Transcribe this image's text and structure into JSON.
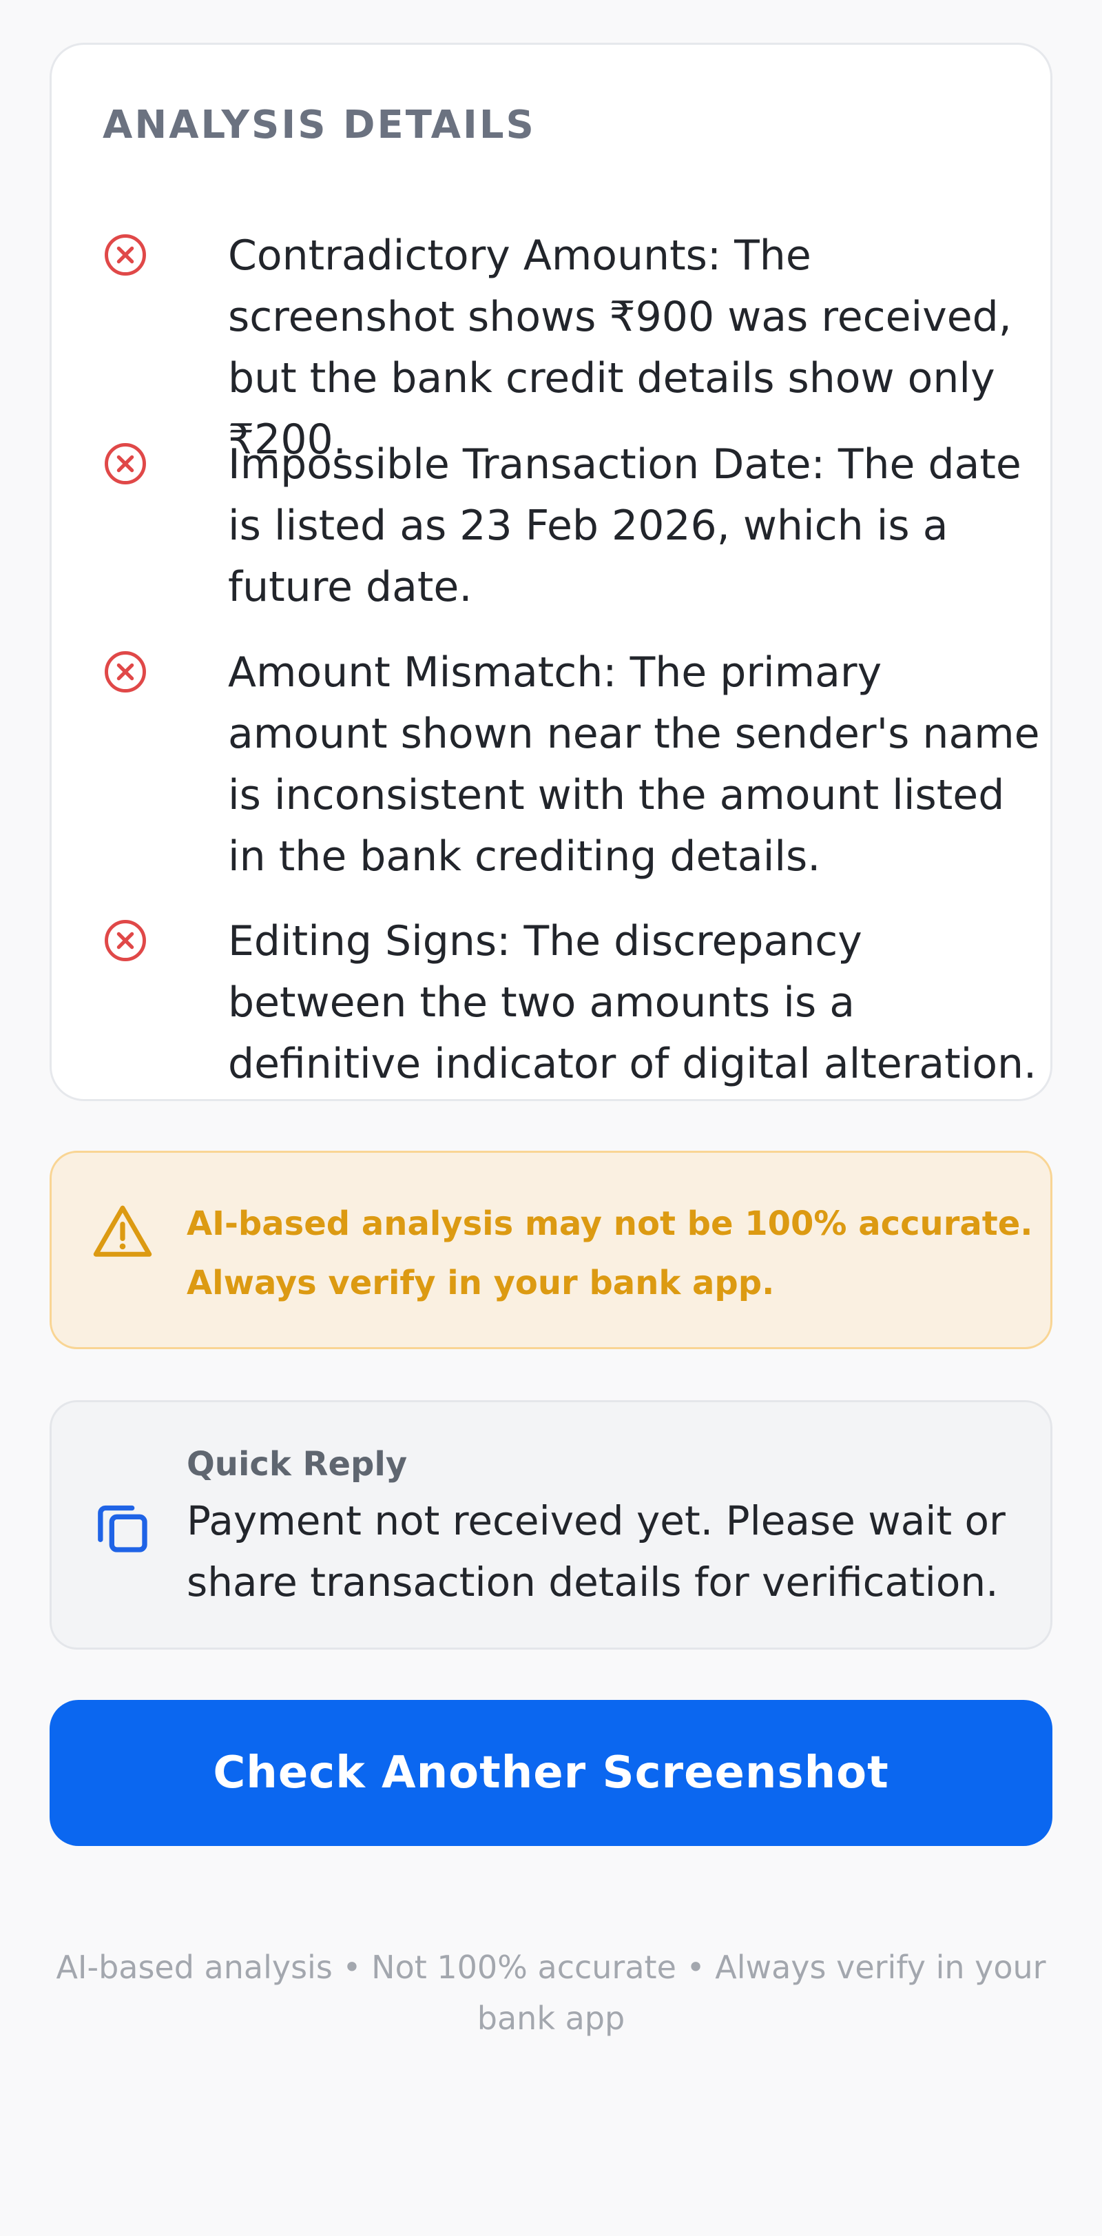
{
  "analysis": {
    "heading": "ANALYSIS DETAILS",
    "findings": [
      {
        "icon": "x-circle-icon",
        "text": "Contradictory Amounts: The screenshot shows ₹900 was received, but the bank credit details show only ₹200."
      },
      {
        "icon": "x-circle-icon",
        "text": "Impossible Transaction Date: The date is listed as 23 Feb 2026, which is a future date."
      },
      {
        "icon": "x-circle-icon",
        "text": "Amount Mismatch: The primary amount shown near the sender's name is inconsistent with the amount listed in the bank crediting details."
      },
      {
        "icon": "x-circle-icon",
        "text": "Editing Signs: The discrepancy between the two amounts is a definitive indicator of digital alteration."
      }
    ]
  },
  "warning": {
    "icon": "warning-triangle-icon",
    "text": "AI-based analysis may not be 100% accurate. Always verify in your bank app."
  },
  "quick_reply": {
    "icon": "copy-icon",
    "label": "Quick Reply",
    "message": "Payment not received yet. Please wait or share transaction details for verification."
  },
  "actions": {
    "check_another_label": "Check Another Screenshot"
  },
  "footer": {
    "note": "AI-based analysis • Not 100% accurate • Always verify in your bank app"
  },
  "colors": {
    "page_background": "#f9f9fa",
    "error_red": "#e04848",
    "warning_amber": "#dc9a12",
    "warning_background": "#faf0e1",
    "primary_blue": "#0b67f0",
    "copy_icon_blue": "#1f63e6"
  }
}
